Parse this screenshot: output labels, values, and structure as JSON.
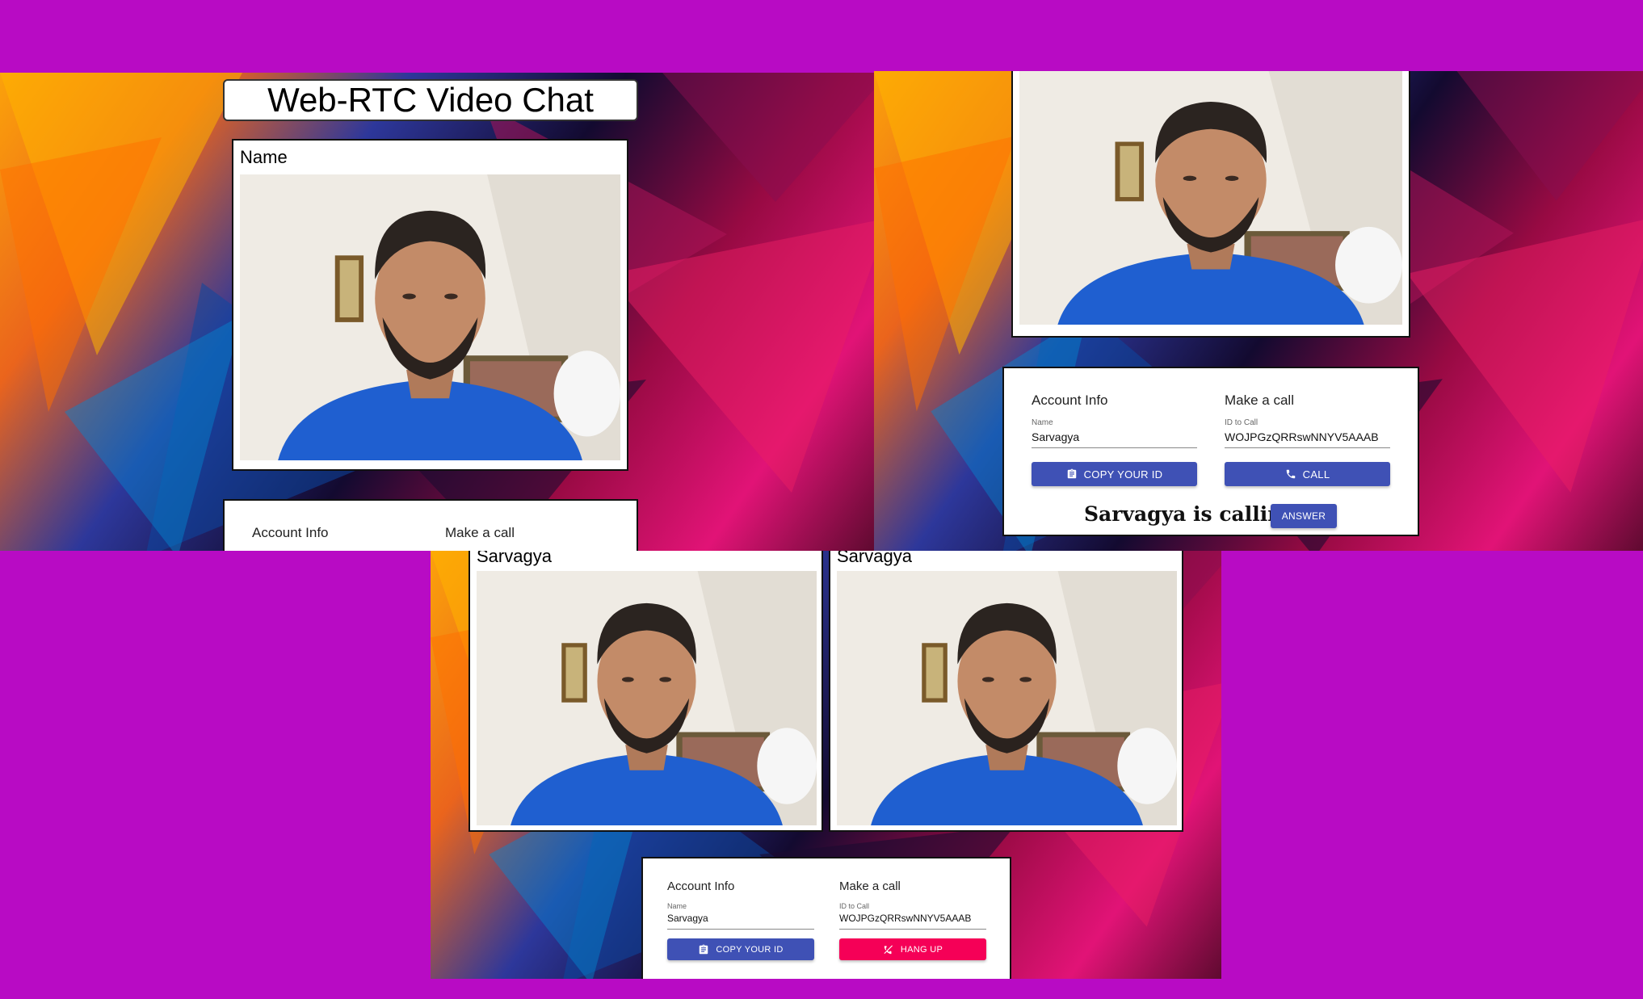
{
  "app_title": "Web-RTC Video Chat",
  "screens": {
    "one": {
      "video_label": "Name",
      "account_heading": "Account Info",
      "call_heading": "Make a call"
    },
    "two": {
      "account_heading": "Account Info",
      "name_label": "Name",
      "name_value": "Sarvagya",
      "call_heading": "Make a call",
      "id_label": "ID to Call",
      "id_value": "WOJPGzQRRswNNYV5AAAB",
      "copy_button": "COPY YOUR ID",
      "call_button": "CALL",
      "calling_text": "Sarvagya is calling!",
      "answer_button": "ANSWER"
    },
    "three": {
      "local_label": "Sarvagya",
      "remote_label": "Sarvagya",
      "account_heading": "Account Info",
      "name_label": "Name",
      "name_value": "Sarvagya",
      "call_heading": "Make a call",
      "id_label": "ID to Call",
      "id_value": "WOJPGzQRRswNNYV5AAAB",
      "copy_button": "COPY YOUR ID",
      "hangup_button": "HANG UP"
    }
  },
  "icons": {
    "copy": "clipboard-icon",
    "call": "phone-icon",
    "hangup": "phone-disabled-icon"
  },
  "colors": {
    "page_background": "#b80bc4",
    "primary_button": "#3f51b5",
    "secondary_button": "#f50057"
  }
}
